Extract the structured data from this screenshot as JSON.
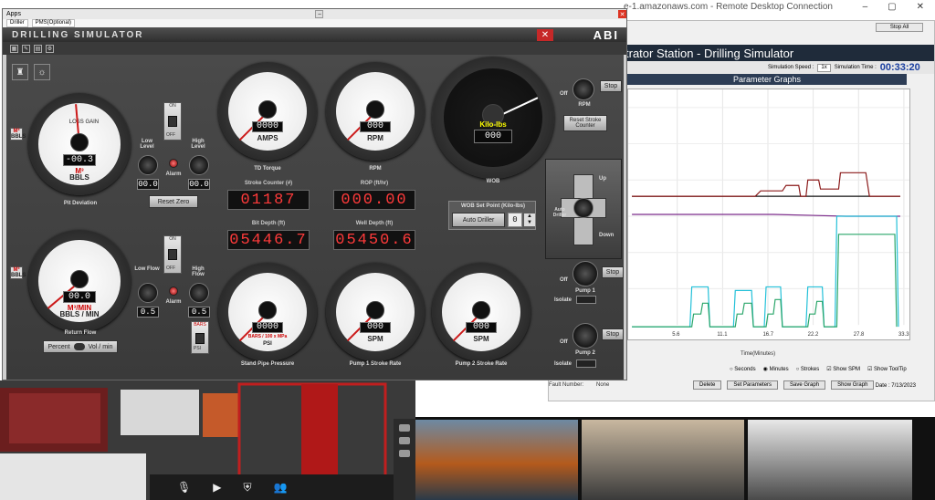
{
  "remote_desktop": {
    "title": "e-1.amazonaws.com - Remote Desktop Connection",
    "controls": [
      "–",
      "▢",
      "✕"
    ]
  },
  "instructor": {
    "stop_all_label": "Stop All",
    "title": "trator Station - Drilling Simulator",
    "speed_label": "Simulation Speed :",
    "speed_value": "1x",
    "time_label": "Simulation Time :",
    "time_value": "00:33:20",
    "panel_title": "Parameter Graphs",
    "x_axis_title": "Time(Minutes)",
    "x_ticks": [
      "5.6",
      "11.1",
      "16.7",
      "22.2",
      "27.8",
      "33.3"
    ],
    "radio_seconds": "Seconds",
    "radio_minutes": "Minutes",
    "radio_strokes": "Strokes",
    "show_spm": "Show SPM",
    "show_tooltip": "Show ToolTip",
    "buttons": [
      "Delete",
      "Set Parameters",
      "Save Graph",
      "Show Graph"
    ],
    "fault_label": "Fault Number:",
    "fault_value": "None",
    "date_label": "Date : 7/13/2023"
  },
  "sim": {
    "apps_label": "Apps",
    "tabs": [
      "Driller",
      "PMS(Optional)"
    ],
    "title": "DRILLING SIMULATOR",
    "logo": "ABI",
    "logo_url": "www.abisimulation.com",
    "pit": {
      "tick_top": "LOSS GAIN",
      "readout": "-00.3",
      "unit_red": "M³",
      "unit": "BBLS",
      "label": "Pit Deviation",
      "left_unit_top": "M³",
      "left_unit_bottom": "BBLS"
    },
    "return_flow": {
      "readout": "00.0",
      "unit_red": "M³/MIN",
      "unit": "BBLS / MIN",
      "label": "Return Flow",
      "left_unit_top": "M³",
      "left_unit_bottom": "BBLS"
    },
    "alarm_pit": {
      "on": "ON",
      "off": "OFF",
      "low_label": "Low Level",
      "high_label": "High Level",
      "alarm": "Alarm",
      "low_value": "00.0",
      "high_value": "00.0"
    },
    "alarm_flow": {
      "on": "ON",
      "off": "OFF",
      "low_label": "Low Flow",
      "high_label": "High Flow",
      "alarm": "Alarm",
      "low_value": "0.5",
      "high_value": "0.5"
    },
    "reset_zero": "Reset Zero",
    "return_toggle": {
      "left": "Percent",
      "right": "Vol / min"
    },
    "amps": {
      "readout": "0000",
      "unit": "AMPS",
      "label": "TD Torque"
    },
    "rpm": {
      "readout": "000",
      "unit": "RPM",
      "label": "RPM"
    },
    "wob": {
      "readout": "000",
      "unit": "Kilo-lbs",
      "label": "WOB"
    },
    "stroke_counter": {
      "label": "Stroke Counter (#)",
      "value": "01187"
    },
    "rop": {
      "label": "ROP (ft/hr)",
      "value": "000.00"
    },
    "bit_depth": {
      "label": "Bit Depth (ft)",
      "value": "05446.7"
    },
    "well_depth": {
      "label": "Well Depth (ft)",
      "value": "05450.6"
    },
    "wob_setpoint": {
      "label": "WOB Set Point (Kilo-lbs)",
      "button": "Auto Driller",
      "value": "0"
    },
    "rpm_switch": {
      "off": "Off",
      "stop": "Stop",
      "label": "RPM"
    },
    "reset_stroke": "Reset Stroke Counter",
    "joystick": {
      "up": "Up",
      "down": "Down",
      "auto": "Auto Driller"
    },
    "spp": {
      "readout": "0000",
      "unit": "BARS / 100 x MPa",
      "unit2": "PSI",
      "label": "Stand Pipe Pressure"
    },
    "pump1_rate": {
      "readout": "000",
      "unit": "SPM",
      "label": "Pump 1 Stroke Rate"
    },
    "pump2_rate": {
      "readout": "000",
      "unit": "SPM",
      "label": "Pump 2 Stroke Rate"
    },
    "pump1": {
      "off": "Off",
      "stop": "Stop",
      "label": "Pump 1",
      "isolate": "Isolate"
    },
    "pump2": {
      "off": "Off",
      "stop": "Stop",
      "label": "Pump 2",
      "isolate": "Isolate"
    },
    "psi_switch": {
      "top": "BARS",
      "bottom": "PSI"
    }
  },
  "chart_data": {
    "type": "line",
    "title": "Parameter Graphs",
    "xlabel": "Time(Minutes)",
    "ylabel": "",
    "x_ticks": [
      5.6,
      11.1,
      16.7,
      22.2,
      27.8,
      33.3
    ],
    "xlim": [
      0,
      33.3
    ],
    "colors": {
      "dark_red": "#8b1a1a",
      "black": "#111111",
      "purple": "#7b2a8a",
      "cyan": "#22c0d8",
      "teal": "#2aa66a"
    }
  }
}
